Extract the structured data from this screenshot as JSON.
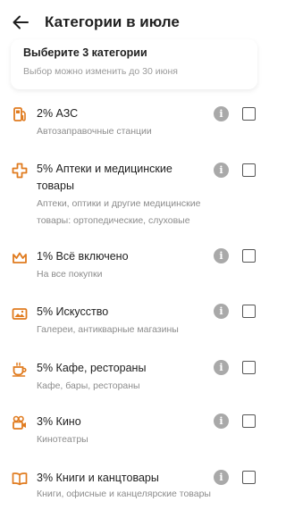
{
  "header": {
    "title": "Категории в июле"
  },
  "info": {
    "title": "Выберите 3 категории",
    "subtitle": "Выбор можно изменить до 30 июня"
  },
  "accent_color": "#e07b1f",
  "categories": [
    {
      "name": "2% АЗС",
      "desc": "Автозаправочные станции",
      "icon": "fuel-pump-icon",
      "checked": false
    },
    {
      "name": "5% Аптеки и медицинские товары",
      "desc": "Аптеки, оптики и другие медицинские товары: ортопедические, слуховые",
      "icon": "medical-cross-icon",
      "checked": false
    },
    {
      "name": "1% Всё включено",
      "desc": "На все покупки",
      "icon": "crown-icon",
      "checked": false
    },
    {
      "name": "5% Искусство",
      "desc": "Галереи, антикварные магазины",
      "icon": "picture-icon",
      "checked": false
    },
    {
      "name": "5% Кафе, рестораны",
      "desc": "Кафе, бары, рестораны",
      "icon": "coffee-cup-icon",
      "checked": false
    },
    {
      "name": "3% Кино",
      "desc": "Кинотеатры",
      "icon": "movie-camera-icon",
      "checked": false
    },
    {
      "name": "3% Книги и канцтовары",
      "desc": "Книги, офисные и канцелярские товары",
      "icon": "book-icon",
      "checked": false
    }
  ]
}
